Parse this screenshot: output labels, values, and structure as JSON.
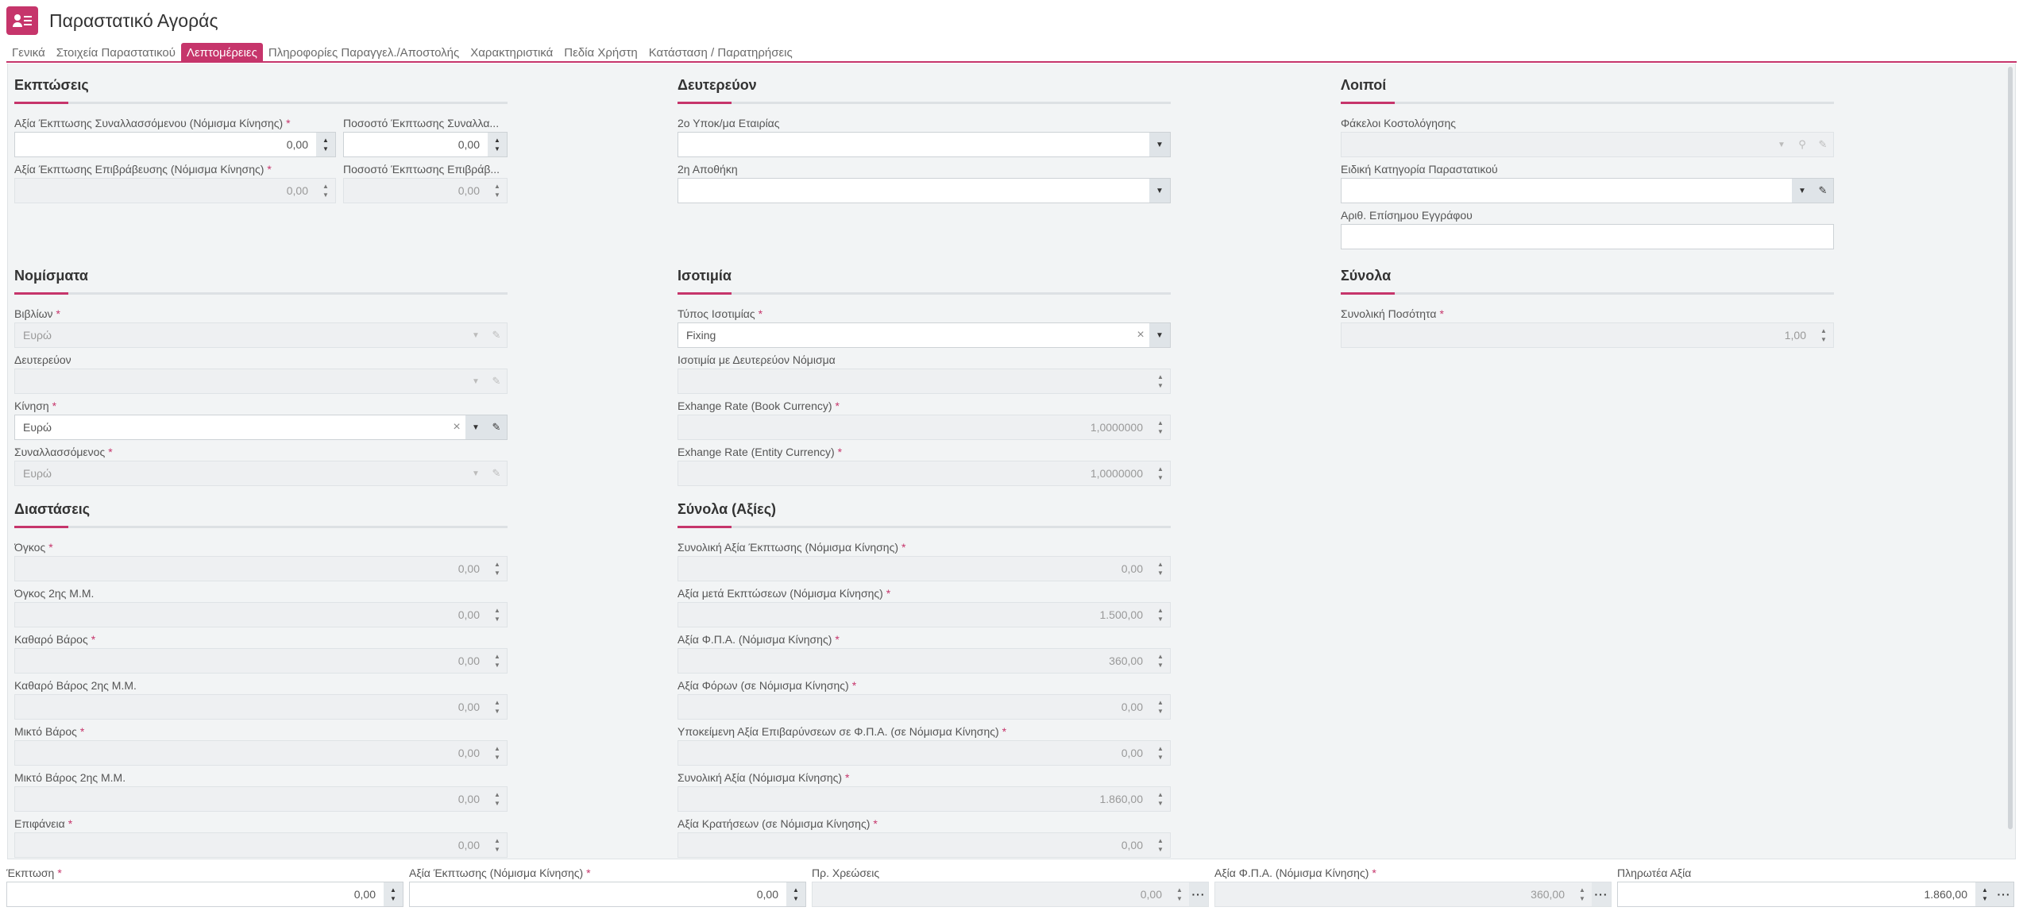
{
  "header": {
    "title": "Παραστατικό Αγοράς",
    "icon": "contact-card-icon"
  },
  "tabs": [
    "Γενικά",
    "Στοιχεία Παραστατικού",
    "Λεπτομέρειες",
    "Πληροφορίες Παραγγελ./Αποστολής",
    "Χαρακτηριστικά",
    "Πεδία Χρήστη",
    "Κατάσταση / Παρατηρήσεις"
  ],
  "active_tab": "Λεπτομέρειες",
  "colors": {
    "accent": "#c6356b"
  },
  "sections": {
    "discounts": {
      "title": "Εκπτώσεις",
      "f1": {
        "label": "Αξία Έκπτωσης Συναλλασσόμενου (Νόμισμα Κίνησης)",
        "value": "0,00"
      },
      "f2": {
        "label": "Ποσοστό Έκπτωσης Συναλλα...",
        "value": "0,00"
      },
      "f3": {
        "label": "Αξία Έκπτωσης Επιβράβευσης (Νόμισμα Κίνησης)",
        "value": "0,00"
      },
      "f4": {
        "label": "Ποσοστό Έκπτωσης Επιβράβ...",
        "value": "0,00"
      }
    },
    "secondary": {
      "title": "Δευτερεύον",
      "f1": {
        "label": "2ο Υποκ/μα Εταιρίας",
        "value": ""
      },
      "f2": {
        "label": "2η Αποθήκη",
        "value": ""
      }
    },
    "other": {
      "title": "Λοιποί",
      "f1": {
        "label": "Φάκελοι Κοστολόγησης",
        "value": ""
      },
      "f2": {
        "label": "Ειδική Κατηγορία Παραστατικού",
        "value": ""
      },
      "f3": {
        "label": "Αριθ. Επίσημου Εγγράφου",
        "value": ""
      }
    },
    "currencies": {
      "title": "Νομίσματα",
      "f1": {
        "label": "Βιβλίων",
        "value": "Ευρώ"
      },
      "f2": {
        "label": "Δευτερεύον",
        "value": ""
      },
      "f3": {
        "label": "Κίνηση",
        "value": "Ευρώ"
      },
      "f4": {
        "label": "Συναλλασσόμενος",
        "value": "Ευρώ"
      }
    },
    "parity": {
      "title": "Ισοτιμία",
      "f1": {
        "label": "Τύπος Ισοτιμίας",
        "value": "Fixing"
      },
      "f2": {
        "label": "Ισοτιμία με Δευτερεύον Νόμισμα",
        "value": ""
      },
      "f3": {
        "label": "Exhange Rate (Book Currency)",
        "value": "1,0000000"
      },
      "f4": {
        "label": "Exhange Rate (Entity Currency)",
        "value": "1,0000000"
      }
    },
    "totals": {
      "title": "Σύνολα",
      "f1": {
        "label": "Συνολική Ποσότητα",
        "value": "1,00"
      }
    },
    "dimensions": {
      "title": "Διαστάσεις",
      "f1": {
        "label": "Όγκος",
        "value": "0,00"
      },
      "f2": {
        "label": "Όγκος 2ης Μ.Μ.",
        "value": "0,00"
      },
      "f3": {
        "label": "Καθαρό Βάρος",
        "value": "0,00"
      },
      "f4": {
        "label": "Καθαρό Βάρος 2ης Μ.Μ.",
        "value": "0,00"
      },
      "f5": {
        "label": "Μικτό Βάρος",
        "value": "0,00"
      },
      "f6": {
        "label": "Μικτό Βάρος 2ης Μ.Μ.",
        "value": "0,00"
      },
      "f7": {
        "label": "Επιφάνεια",
        "value": "0,00"
      }
    },
    "value_totals": {
      "title": "Σύνολα (Αξίες)",
      "f1": {
        "label": "Συνολική Αξία Έκπτωσης (Νόμισμα Κίνησης)",
        "value": "0,00"
      },
      "f2": {
        "label": "Αξία μετά Εκπτώσεων (Νόμισμα Κίνησης)",
        "value": "1.500,00"
      },
      "f3": {
        "label": "Αξία Φ.Π.Α. (Νόμισμα Κίνησης)",
        "value": "360,00"
      },
      "f4": {
        "label": "Αξία Φόρων (σε Νόμισμα Κίνησης)",
        "value": "0,00"
      },
      "f5": {
        "label": "Υποκείμενη Αξία Επιβαρύνσεων σε Φ.Π.Α. (σε Νόμισμα Κίνησης)",
        "value": "0,00"
      },
      "f6": {
        "label": "Συνολική Αξία (Νόμισμα Κίνησης)",
        "value": "1.860,00"
      },
      "f7": {
        "label": "Αξία Κρατήσεων (σε Νόμισμα Κίνησης)",
        "value": "0,00"
      }
    }
  },
  "footer": {
    "f1": {
      "label": "Έκπτωση",
      "value": "0,00"
    },
    "f2": {
      "label": "Αξία Έκπτωσης (Νόμισμα Κίνησης)",
      "value": "0,00"
    },
    "f3": {
      "label": "Πρ. Χρεώσεις",
      "value": "0,00"
    },
    "f4": {
      "label": "Αξία Φ.Π.Α. (Νόμισμα Κίνησης)",
      "value": "360,00"
    },
    "f5": {
      "label": "Πληρωτέα Αξία",
      "value": "1.860,00"
    }
  }
}
